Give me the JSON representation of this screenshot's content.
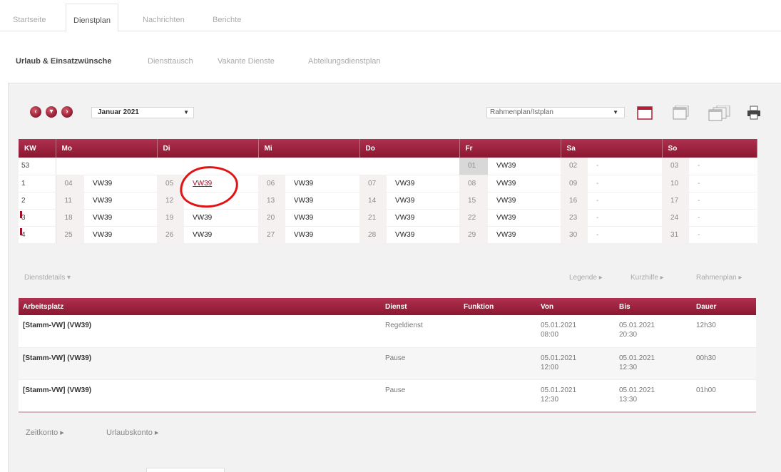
{
  "top_tabs": [
    {
      "label": "Startseite",
      "active": false
    },
    {
      "label": "Dienstplan",
      "active": true
    },
    {
      "label": "Nachrichten",
      "active": false
    },
    {
      "label": "Berichte",
      "active": false
    }
  ],
  "sub_nav": [
    {
      "label": "Urlaub & Einsatzwünsche",
      "active": true
    },
    {
      "label": "Diensttausch",
      "active": false
    },
    {
      "label": "Vakante Dienste",
      "active": false
    },
    {
      "label": "Abteilungsdienstplan",
      "active": false
    }
  ],
  "toolbar": {
    "month_value": "Januar 2021",
    "plan_value": "Rahmenplan/Istplan",
    "icons": [
      "prev-arrow-icon",
      "down-arrow-icon",
      "next-arrow-icon",
      "calendar-day-icon",
      "calendar-week-icon",
      "calendar-month-icon",
      "printer-icon"
    ]
  },
  "calendar": {
    "headers": [
      "KW",
      "Mo",
      "Di",
      "Mi",
      "Do",
      "Fr",
      "Sa",
      "So"
    ],
    "rows": [
      {
        "kw": "53",
        "days": [
          [
            "",
            ""
          ],
          [
            "",
            ""
          ],
          [
            "",
            ""
          ],
          [
            "",
            ""
          ],
          [
            "01",
            "VW39"
          ],
          [
            "02",
            "-"
          ],
          [
            "03",
            "-"
          ]
        ]
      },
      {
        "kw": "1",
        "days": [
          [
            "04",
            "VW39"
          ],
          [
            "05",
            "VW39"
          ],
          [
            "06",
            "VW39"
          ],
          [
            "07",
            "VW39"
          ],
          [
            "08",
            "VW39"
          ],
          [
            "09",
            "-"
          ],
          [
            "10",
            "-"
          ]
        ]
      },
      {
        "kw": "2",
        "days": [
          [
            "11",
            "VW39"
          ],
          [
            "12",
            ""
          ],
          [
            "13",
            "VW39"
          ],
          [
            "14",
            "VW39"
          ],
          [
            "15",
            "VW39"
          ],
          [
            "16",
            "-"
          ],
          [
            "17",
            "-"
          ]
        ]
      },
      {
        "kw": "3",
        "days": [
          [
            "18",
            "VW39"
          ],
          [
            "19",
            "VW39"
          ],
          [
            "20",
            "VW39"
          ],
          [
            "21",
            "VW39"
          ],
          [
            "22",
            "VW39"
          ],
          [
            "23",
            "-"
          ],
          [
            "24",
            "-"
          ]
        ]
      },
      {
        "kw": "4",
        "days": [
          [
            "25",
            "VW39"
          ],
          [
            "26",
            "VW39"
          ],
          [
            "27",
            "VW39"
          ],
          [
            "28",
            "VW39"
          ],
          [
            "29",
            "VW39"
          ],
          [
            "30",
            "-"
          ],
          [
            "31",
            "-"
          ]
        ]
      }
    ]
  },
  "details_bar": {
    "dienstdetails": "Dienstdetails ▾",
    "legende": "Legende ▸",
    "kurzhilfe": "Kurzhilfe ▸",
    "rahmenplan": "Rahmenplan ▸"
  },
  "detail_table": {
    "headers": [
      "Arbeitsplatz",
      "Dienst",
      "Funktion",
      "Von",
      "Bis",
      "Dauer"
    ],
    "rows": [
      {
        "arbeitsplatz": "[Stamm-VW] (VW39)",
        "dienst": "Regeldienst",
        "funktion": "",
        "von_date": "05.01.2021",
        "von_time": "08:00",
        "bis_date": "05.01.2021",
        "bis_time": "20:30",
        "dauer": "12h30"
      },
      {
        "arbeitsplatz": "[Stamm-VW] (VW39)",
        "dienst": "Pause",
        "funktion": "",
        "von_date": "05.01.2021",
        "von_time": "12:00",
        "bis_date": "05.01.2021",
        "bis_time": "12:30",
        "dauer": "00h30"
      },
      {
        "arbeitsplatz": "[Stamm-VW] (VW39)",
        "dienst": "Pause",
        "funktion": "",
        "von_date": "05.01.2021",
        "von_time": "12:30",
        "bis_date": "05.01.2021",
        "bis_time": "13:30",
        "dauer": "01h00"
      }
    ]
  },
  "footer": {
    "zeitkonto": "Zeitkonto ▸",
    "urlaubskonto": "Urlaubskonto ▸"
  },
  "colors": {
    "accent": "#9a1f38",
    "annotation_circle": "#e01414"
  }
}
